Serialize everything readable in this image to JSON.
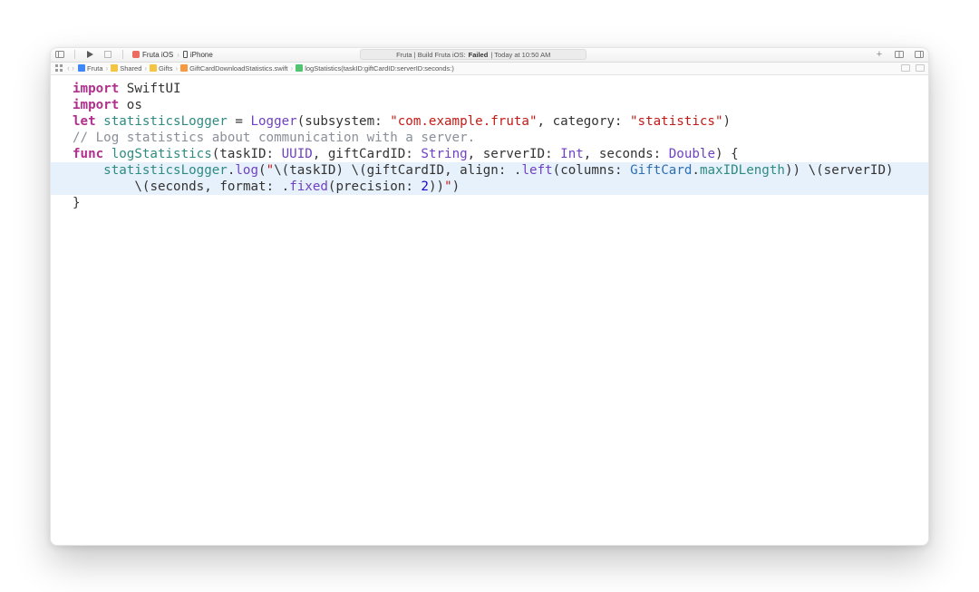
{
  "toolbar": {
    "scheme_name": "Fruta iOS",
    "device": "iPhone",
    "status_prefix": "Fruta | Build Fruta iOS:",
    "status_result": "Failed",
    "status_time": "| Today at 10:50 AM"
  },
  "jumpbar": {
    "crumbs": [
      {
        "icon": "fi-blue",
        "label": "Fruta"
      },
      {
        "icon": "fi-yellow",
        "label": "Shared"
      },
      {
        "icon": "fi-yellow",
        "label": "Gifts"
      },
      {
        "icon": "fi-orange",
        "label": "GiftCardDownloadStatistics.swift"
      },
      {
        "icon": "fi-green",
        "label": "logStatistics(taskID:giftCardID:serverID:seconds:)"
      }
    ]
  },
  "code": {
    "l1a": "import",
    "l1b": " SwiftUI",
    "l2a": "import",
    "l2b": " os",
    "blank": "",
    "l4a": "let",
    "l4b": " statisticsLogger",
    "l4c": " = ",
    "l4d": "Logger",
    "l4e": "(subsystem: ",
    "l4f": "\"com.example.fruta\"",
    "l4g": ", category: ",
    "l4h": "\"statistics\"",
    "l4i": ")",
    "l6": "// Log statistics about communication with a server.",
    "l7a": "func",
    "l7b": " logStatistics",
    "l7c": "(taskID: ",
    "l7d": "UUID",
    "l7e": ", giftCardID: ",
    "l7f": "String",
    "l7g": ", serverID: ",
    "l7h": "Int",
    "l7i": ", seconds: ",
    "l7j": "Double",
    "l7k": ") {",
    "l8a": "    ",
    "l8b": "statisticsLogger",
    "l8c": ".",
    "l8d": "log",
    "l8e": "(",
    "l8f": "\"",
    "l8g": "\\(",
    "l8h": "taskID",
    "l8i": ")",
    "l8j": " ",
    "l8k": "\\(",
    "l8l": "giftCardID",
    "l8m": ", align: .",
    "l8n": "left",
    "l8o": "(columns: ",
    "l8p": "GiftCard",
    "l8q": ".",
    "l8r": "maxIDLength",
    "l8s": ")",
    "l8t": ")",
    "l8u": " ",
    "l8v": "\\(",
    "l8w": "serverID",
    "l8x": ")",
    "l9a": "        ",
    "l9b": "\\(",
    "l9c": "seconds",
    "l9d": ", format: .",
    "l9e": "fixed",
    "l9f": "(precision: ",
    "l9g": "2",
    "l9h": ")",
    "l9i": ")",
    "l9j": "\"",
    "l9k": ")",
    "l10": "}"
  }
}
